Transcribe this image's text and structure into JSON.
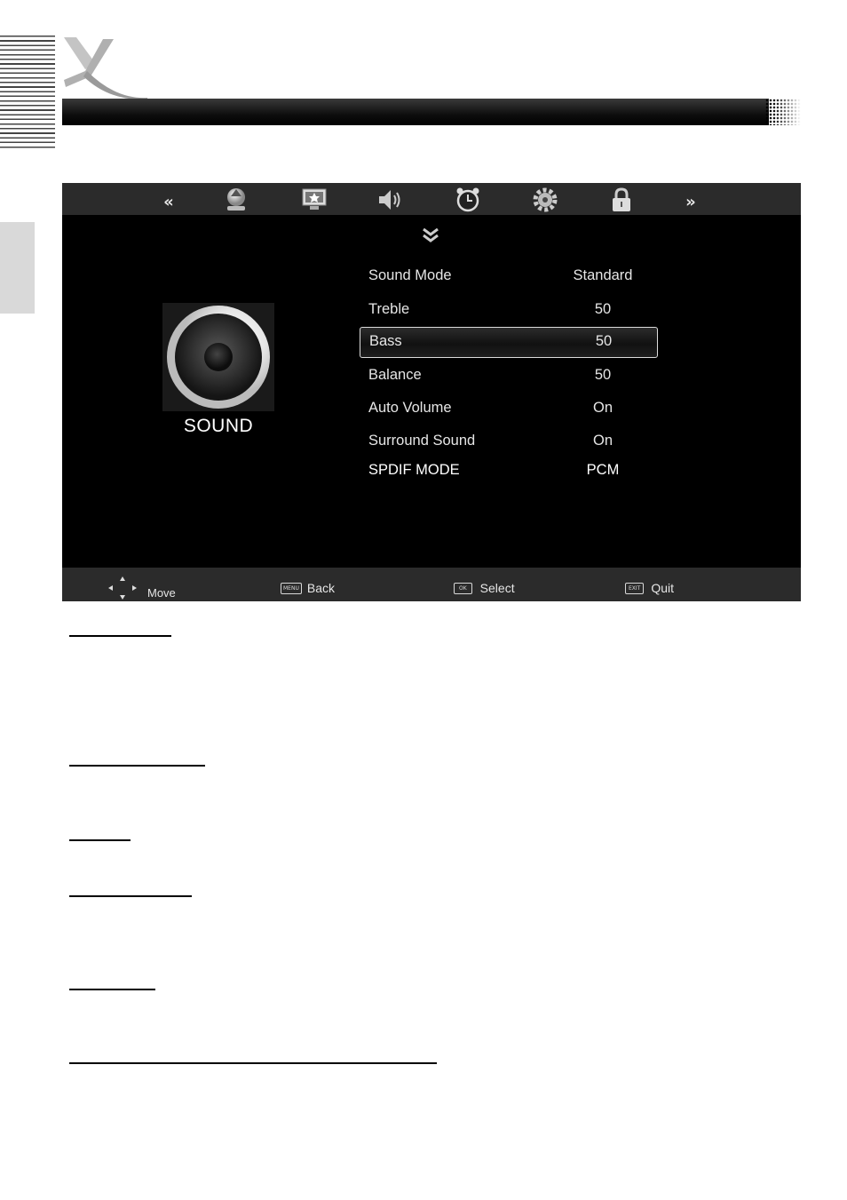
{
  "screen": {
    "nav": {
      "prev_arrow": "«",
      "next_arrow": "»",
      "icons": [
        "picture-icon",
        "screen-icon",
        "speaker-icon",
        "clock-icon",
        "gear-icon",
        "lock-icon"
      ]
    },
    "panel": {
      "label": "SOUND"
    },
    "menu": [
      {
        "label": "Sound Mode",
        "value": "Standard"
      },
      {
        "label": "Treble",
        "value": "50"
      },
      {
        "label": "Bass",
        "value": "50",
        "selected": true
      },
      {
        "label": "Balance",
        "value": "50"
      },
      {
        "label": "Auto Volume",
        "value": "On"
      },
      {
        "label": "Surround Sound",
        "value": "On"
      },
      {
        "label": "SPDIF MODE",
        "value": "PCM"
      }
    ],
    "hints": {
      "move": {
        "label": "Move"
      },
      "back": {
        "key": "MENU",
        "label": "Back"
      },
      "select": {
        "key": "OK",
        "label": "Select"
      },
      "quit": {
        "key": "EXIT",
        "label": "Quit"
      }
    }
  }
}
